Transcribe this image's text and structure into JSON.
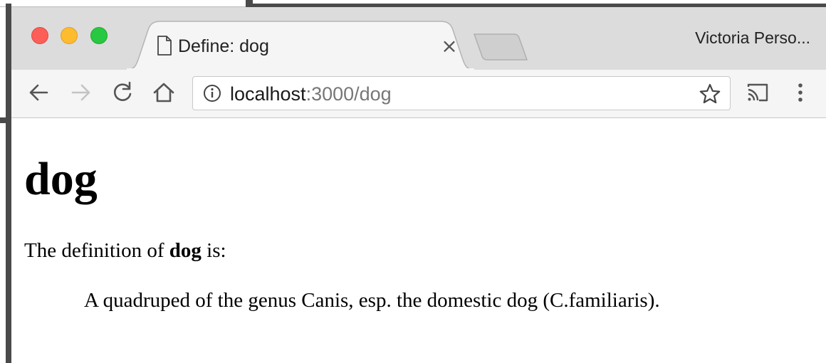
{
  "browser": {
    "tab": {
      "title": "Define: dog",
      "close_glyph": "×",
      "icon": "document-icon"
    },
    "profile_name": "Victoria Perso...",
    "toolbar": {
      "back_icon": "arrow-left-icon",
      "forward_icon": "arrow-right-icon",
      "reload_icon": "reload-icon",
      "home_icon": "home-icon",
      "cast_icon": "cast-icon",
      "menu_icon": "kebab-menu-icon"
    },
    "omnibox": {
      "info_icon": "info-icon",
      "host": "localhost",
      "rest": ":3000/dog",
      "bookmark_icon": "star-icon"
    },
    "colors": {
      "close_red": "#fc5f57",
      "minimize_yellow": "#fdbc2e",
      "maximize_green": "#28c840",
      "tabstrip_bg": "#dcdcdc",
      "toolbar_bg": "#f5f5f5"
    }
  },
  "page": {
    "heading": "dog",
    "intro_before": "The definition of ",
    "intro_term": "dog",
    "intro_after": " is:",
    "definition": "A quadruped of the genus Canis, esp. the domestic dog (C.familiaris)."
  }
}
